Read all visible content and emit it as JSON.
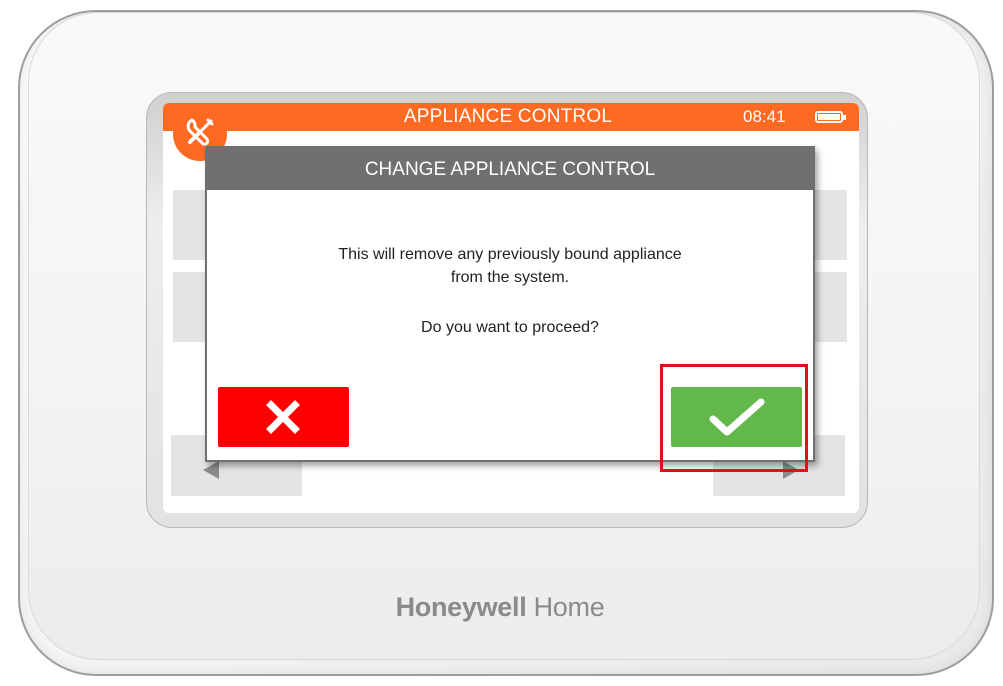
{
  "device": {
    "brand_primary": "Honeywell",
    "brand_secondary": "Home"
  },
  "header": {
    "title": "APPLIANCE CONTROL",
    "time": "08:41",
    "accent_color": "#ff6a22",
    "settings_icon": "wrench-screwdriver-icon",
    "battery_icon": "battery-full-icon"
  },
  "dialog": {
    "title": "CHANGE APPLIANCE CONTROL",
    "message_line1": "This will remove any previously bound appliance",
    "message_line2": "from the system.",
    "question": "Do you want to proceed?",
    "cancel_icon": "close-x-icon",
    "cancel_color": "#ff0000",
    "confirm_icon": "checkmark-icon",
    "confirm_color": "#63b84c"
  },
  "highlight": {
    "target": "confirm-button",
    "color": "#e01018"
  }
}
